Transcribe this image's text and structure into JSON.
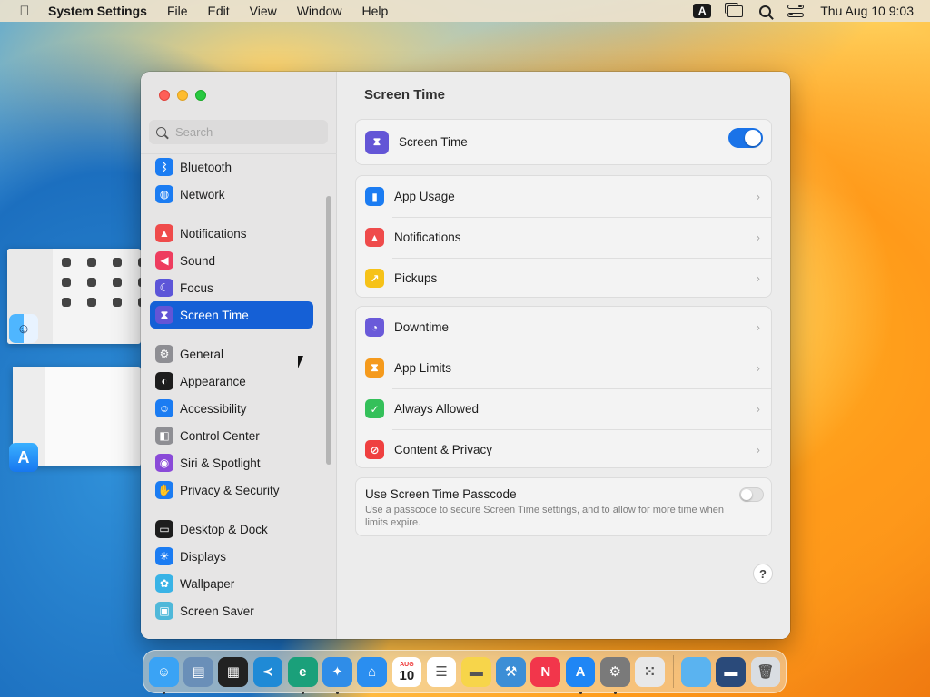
{
  "menubar": {
    "app_name": "System Settings",
    "menus": [
      "File",
      "Edit",
      "View",
      "Window",
      "Help"
    ],
    "input_indicator": "A",
    "clock": "Thu Aug 10  9:03"
  },
  "window": {
    "search_placeholder": "Search",
    "sidebar": [
      {
        "label": "Bluetooth",
        "icon": "bluetooth-icon",
        "color": "#1b7cf2",
        "glyph": "ᛒ"
      },
      {
        "label": "Network",
        "icon": "network-globe-icon",
        "color": "#1b7cf2",
        "glyph": "◍"
      },
      {
        "label": "Notifications",
        "icon": "notifications-bell-icon",
        "color": "#ef4b4b",
        "glyph": "▲"
      },
      {
        "label": "Sound",
        "icon": "speaker-icon",
        "color": "#ee3d5f",
        "glyph": "◀"
      },
      {
        "label": "Focus",
        "icon": "moon-icon",
        "color": "#5d55d8",
        "glyph": "☾"
      },
      {
        "label": "Screen Time",
        "icon": "hourglass-icon",
        "color": "#6355d6",
        "glyph": "⧗"
      },
      {
        "label": "General",
        "icon": "gear-icon",
        "color": "#8e8e93",
        "glyph": "⚙"
      },
      {
        "label": "Appearance",
        "icon": "appearance-icon",
        "color": "#1d1d1d",
        "glyph": "◐"
      },
      {
        "label": "Accessibility",
        "icon": "accessibility-icon",
        "color": "#1b7cf2",
        "glyph": "☺"
      },
      {
        "label": "Control Center",
        "icon": "control-center-icon",
        "color": "#8e8e93",
        "glyph": "◧"
      },
      {
        "label": "Siri & Spotlight",
        "icon": "siri-icon",
        "color": "#8a4ad8",
        "glyph": "◉"
      },
      {
        "label": "Privacy & Security",
        "icon": "hand-icon",
        "color": "#1b7cf2",
        "glyph": "✋"
      },
      {
        "label": "Desktop & Dock",
        "icon": "dock-icon",
        "color": "#1d1d1d",
        "glyph": "▭"
      },
      {
        "label": "Displays",
        "icon": "sun-icon",
        "color": "#1b7cf2",
        "glyph": "☀"
      },
      {
        "label": "Wallpaper",
        "icon": "wallpaper-icon",
        "color": "#39b3e6",
        "glyph": "✿"
      },
      {
        "label": "Screen Saver",
        "icon": "screen-saver-icon",
        "color": "#4fb8d9",
        "glyph": "▣"
      }
    ],
    "selected": "Screen Time",
    "title": "Screen Time",
    "toggle_row": {
      "label": "Screen Time",
      "enabled": true
    },
    "group1": [
      {
        "label": "App Usage",
        "icon": "bar-chart-icon",
        "color": "#1b7cf2",
        "glyph": "▮"
      },
      {
        "label": "Notifications",
        "icon": "notifications-bell-icon",
        "color": "#ef4b4b",
        "glyph": "▲"
      },
      {
        "label": "Pickups",
        "icon": "pickups-icon",
        "color": "#f6c218",
        "glyph": "↗"
      }
    ],
    "group2": [
      {
        "label": "Downtime",
        "icon": "downtime-icon",
        "color": "#6a5ad9",
        "glyph": "◔"
      },
      {
        "label": "App Limits",
        "icon": "hourglass-icon",
        "color": "#f59a1c",
        "glyph": "⧗"
      },
      {
        "label": "Always Allowed",
        "icon": "checkmark-icon",
        "color": "#34c05a",
        "glyph": "✓"
      },
      {
        "label": "Content & Privacy",
        "icon": "no-symbol-icon",
        "color": "#ef4040",
        "glyph": "⊘"
      }
    ],
    "passcode": {
      "title": "Use Screen Time Passcode",
      "description": "Use a passcode to secure Screen Time settings, and to allow for more time when limits expire.",
      "enabled": false
    },
    "help_label": "?"
  },
  "dock": {
    "calendar_month": "AUG",
    "calendar_day": "10",
    "items": [
      {
        "name": "finder-icon",
        "color": "#3aa3f5",
        "glyph": "☺",
        "running": true
      },
      {
        "name": "preview-icon",
        "color": "#6a8fb8",
        "glyph": "▤",
        "running": false
      },
      {
        "name": "mission-control-icon",
        "color": "#222222",
        "glyph": "▦",
        "running": false
      },
      {
        "name": "vscode-icon",
        "color": "#1f8ad6",
        "glyph": "≺",
        "running": false
      },
      {
        "name": "edge-icon",
        "color": "#1aa07a",
        "glyph": "e",
        "running": true
      },
      {
        "name": "safari-icon",
        "color": "#2f8de8",
        "glyph": "✦",
        "running": true
      },
      {
        "name": "keynote-icon",
        "color": "#2a8ef0",
        "glyph": "⌂",
        "running": false
      },
      {
        "name": "calendar-icon",
        "color": "#ffffff",
        "glyph": "",
        "running": false
      },
      {
        "name": "reminders-icon",
        "color": "#ffffff",
        "glyph": "☰",
        "running": false
      },
      {
        "name": "notes-icon",
        "color": "#f7d54a",
        "glyph": "▬",
        "running": false
      },
      {
        "name": "xcode-icon",
        "color": "#3c8ed6",
        "glyph": "⚒",
        "running": false
      },
      {
        "name": "news-icon",
        "color": "#f2364b",
        "glyph": "N",
        "running": false
      },
      {
        "name": "app-store-icon",
        "color": "#1f86f5",
        "glyph": "A",
        "running": true
      },
      {
        "name": "system-settings-icon",
        "color": "#7a7a7a",
        "glyph": "⚙",
        "running": true
      },
      {
        "name": "launchpad-icon",
        "color": "#e8e8e8",
        "glyph": "⁙",
        "running": false
      }
    ],
    "trailing": [
      {
        "name": "folder-icon",
        "color": "#5ab3f0",
        "glyph": ""
      },
      {
        "name": "screenshot-folder-icon",
        "color": "#2a4a7a",
        "glyph": "▬"
      },
      {
        "name": "trash-icon",
        "color": "#d9dde2",
        "glyph": "🗑"
      }
    ]
  }
}
